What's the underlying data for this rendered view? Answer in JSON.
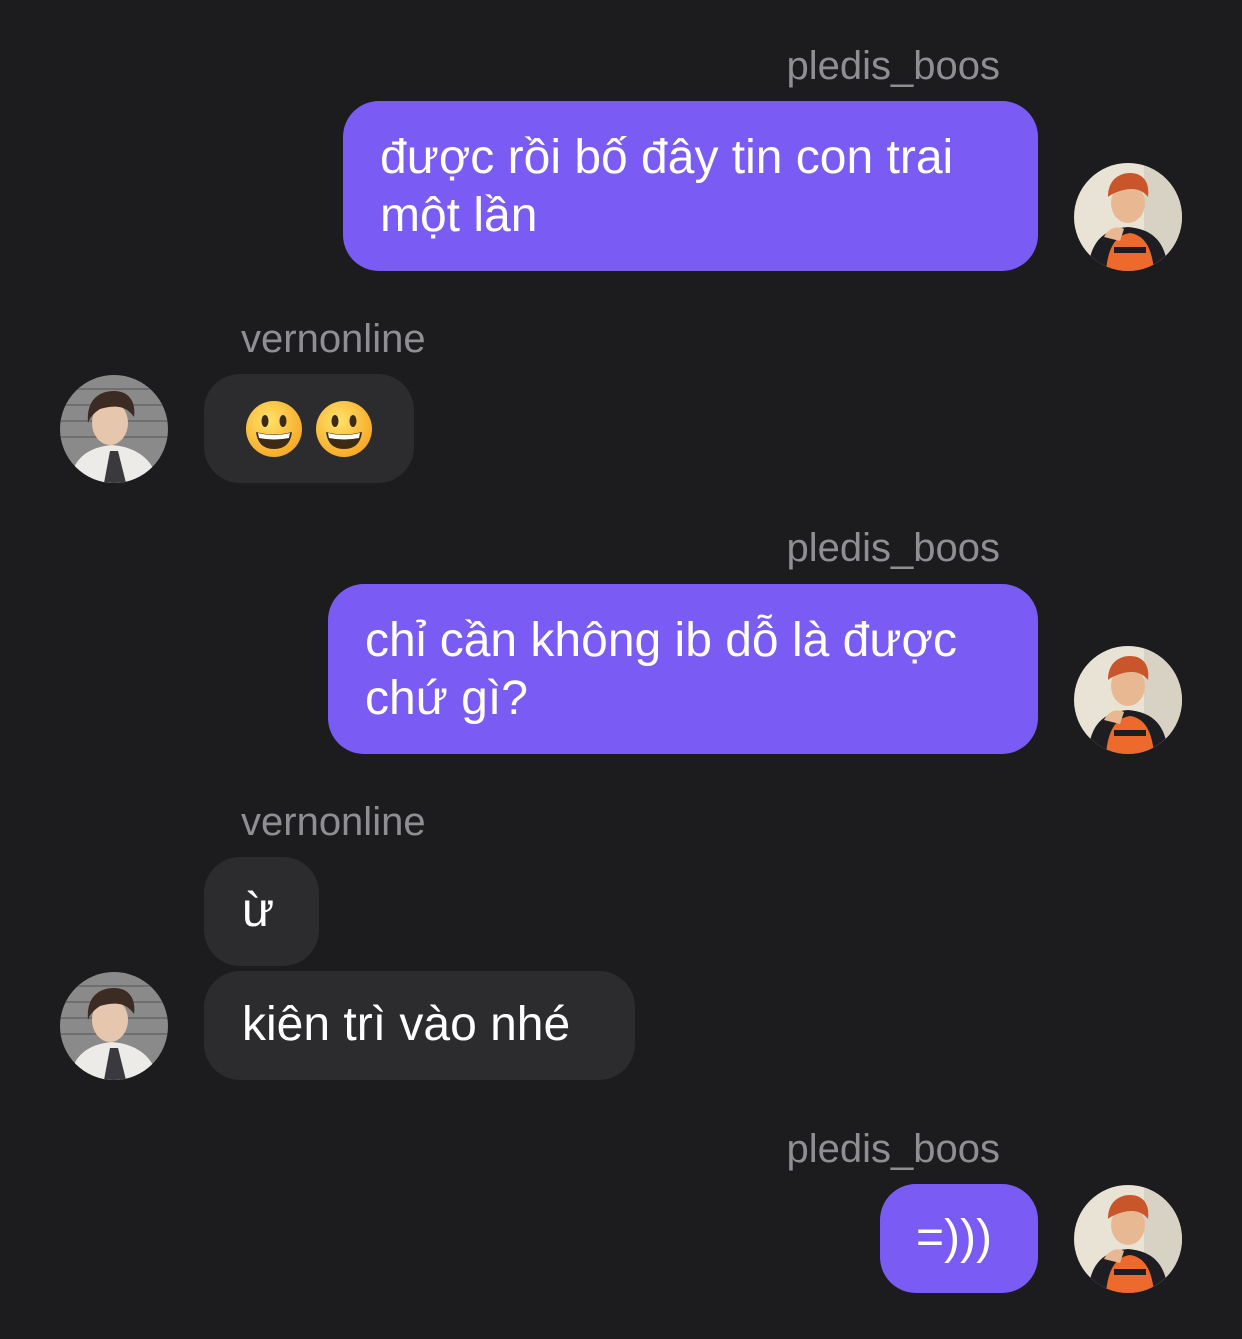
{
  "users": {
    "me": "pledis_boos",
    "other": "vernonline"
  },
  "messages": [
    {
      "sender": "pledis_boos",
      "text": "được rồi bố đây tin con trai một lần"
    },
    {
      "sender": "vernonline",
      "text": "😀😀",
      "emoji": [
        "grinning-face",
        "grinning-face"
      ]
    },
    {
      "sender": "pledis_boos",
      "text": "chỉ cần không ib dỗ là được chứ gì?"
    },
    {
      "sender": "vernonline",
      "text": "ừ"
    },
    {
      "sender": "vernonline",
      "text": "kiên trì vào nhé"
    },
    {
      "sender": "pledis_boos",
      "text": "=)))"
    }
  ],
  "colors": {
    "background": "#1c1c1f",
    "outgoing_bubble": "#7a5cf5",
    "incoming_bubble": "#2c2c2f",
    "username": "#8e8e93",
    "text": "#ffffff"
  }
}
